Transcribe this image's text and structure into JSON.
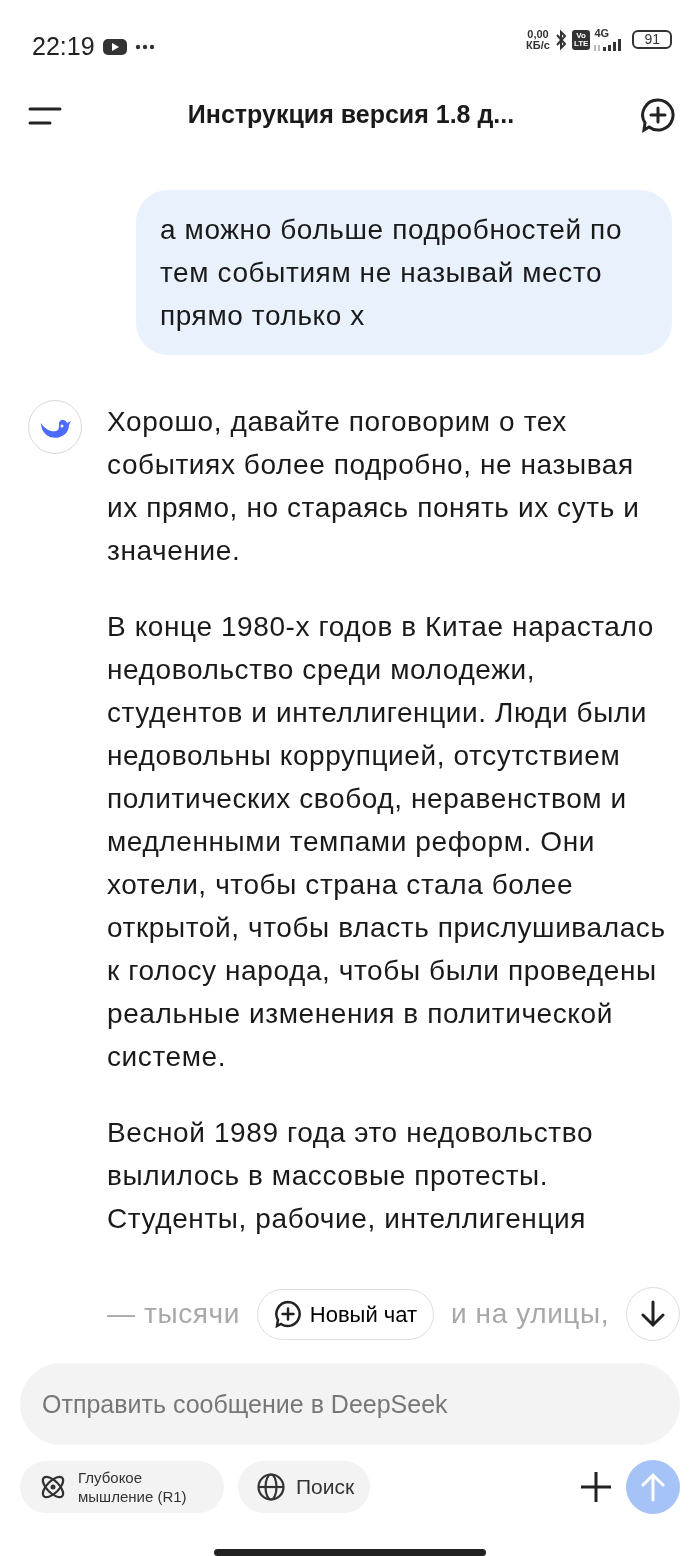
{
  "status_bar": {
    "time": "22:19",
    "speed_value": "0,00",
    "speed_unit": "КБ/с",
    "volte_top": "Vo",
    "volte_bottom": "LTE",
    "network": "4G",
    "battery": "91"
  },
  "header": {
    "title": "Инструкция версия 1.8 д..."
  },
  "messages": [
    {
      "kind": "user",
      "paragraphs": [
        "а можно больше подробностей по тем событиям не называй место прямо только х"
      ]
    },
    {
      "kind": "assistant",
      "paragraphs": [
        "Хорошо, давайте поговорим о тех событиях более подробно, не называя их прямо, но стараясь понять их суть и значение.",
        "В конце 1980-х годов в Китае нарастало недовольство среди молодежи, студентов и интеллигенции. Люди были недовольны коррупцией, отсутствием политических свобод, неравенством и медленными темпами реформ. Они хотели, чтобы страна стала более открытой, чтобы власть прислушивалась к голосу народа, чтобы были проведены реальные изменения в политической системе.",
        "Весной 1989 года это недовольство вылилось в массовые протесты. Студенты, рабочие, интеллигенция"
      ],
      "faded_left": "— тысячи",
      "faded_right": "и на улицы,"
    }
  ],
  "new_chat_button": "Новый чат",
  "composer": {
    "placeholder": "Отправить сообщение в DeepSeek"
  },
  "toggles": [
    {
      "kind": "deepthink",
      "label": "Глубокое мышление (R1)",
      "selected": false
    },
    {
      "kind": "search",
      "label": "Поиск",
      "selected": false
    }
  ],
  "send_button": {
    "disabled": true
  }
}
